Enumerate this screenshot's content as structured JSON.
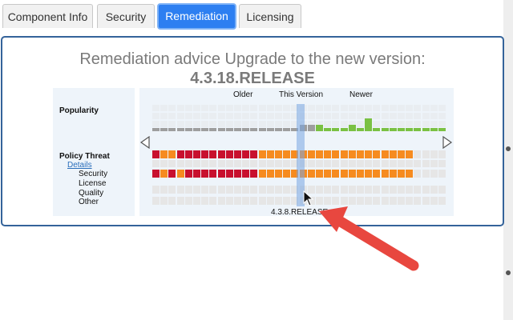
{
  "tabs": [
    {
      "label": "Component Info",
      "active": false
    },
    {
      "label": "Security",
      "active": false
    },
    {
      "label": "Remediation",
      "active": true
    },
    {
      "label": "Licensing",
      "active": false
    }
  ],
  "remediation": {
    "heading_line1": "Remediation advice Upgrade to the new version:",
    "heading_line2": "4.3.18.RELEASE"
  },
  "legend": {
    "popularity": "Popularity",
    "policy_threat": "Policy Threat",
    "details_link": "Details",
    "categories": [
      "Security",
      "License",
      "Quality",
      "Other"
    ]
  },
  "version_axis": {
    "older": "Older",
    "this_version": "This Version",
    "newer": "Newer",
    "current_version_label": "4.3.8.RELEASE"
  },
  "colors": {
    "critical": "#c8102e",
    "severe": "#f68b1f",
    "empty": "#e6e6e6",
    "popularity_old": "#9e9e9e",
    "popularity_new": "#7ac143",
    "panel_border": "#34639a",
    "active_tab": "#2d7ff1",
    "annotation_arrow": "#e8473f"
  },
  "grid": {
    "columns": 36,
    "current_index": 19,
    "popularity_levels": [
      1,
      1,
      1,
      1,
      1,
      1,
      1,
      1,
      1,
      1,
      1,
      1,
      1,
      1,
      1,
      1,
      1,
      1,
      2,
      2,
      2,
      1,
      1,
      1,
      2,
      1,
      4,
      1,
      1,
      1,
      1,
      1,
      1,
      1,
      1,
      1
    ],
    "security_row": [
      "c",
      "s",
      "s",
      "c",
      "c",
      "c",
      "c",
      "c",
      "c",
      "c",
      "c",
      "c",
      "c",
      "s",
      "s",
      "s",
      "s",
      "s",
      "s",
      "s",
      "s",
      "s",
      "s",
      "s",
      "s",
      "s",
      "s",
      "s",
      "s",
      "s",
      "s",
      "s",
      "e",
      "e",
      "e",
      "e"
    ],
    "license_row": [
      "c",
      "s",
      "c",
      "s",
      "c",
      "c",
      "c",
      "c",
      "c",
      "c",
      "c",
      "c",
      "c",
      "s",
      "s",
      "s",
      "s",
      "s",
      "s",
      "s",
      "s",
      "s",
      "s",
      "s",
      "s",
      "s",
      "s",
      "s",
      "s",
      "s",
      "s",
      "s",
      "e",
      "e",
      "e",
      "e"
    ],
    "quality_row": [
      "e",
      "e",
      "e",
      "e",
      "e",
      "e",
      "e",
      "e",
      "e",
      "e",
      "e",
      "e",
      "e",
      "e",
      "e",
      "e",
      "e",
      "e",
      "e",
      "e",
      "e",
      "e",
      "e",
      "e",
      "e",
      "e",
      "e",
      "e",
      "e",
      "e",
      "e",
      "e",
      "e",
      "e",
      "e",
      "e"
    ],
    "other_row": [
      "e",
      "e",
      "e",
      "e",
      "e",
      "e",
      "e",
      "e",
      "e",
      "e",
      "e",
      "e",
      "e",
      "e",
      "e",
      "e",
      "e",
      "e",
      "e",
      "e",
      "e",
      "e",
      "e",
      "e",
      "e",
      "e",
      "e",
      "e",
      "e",
      "e",
      "e",
      "e",
      "e",
      "e",
      "e",
      "e"
    ]
  }
}
